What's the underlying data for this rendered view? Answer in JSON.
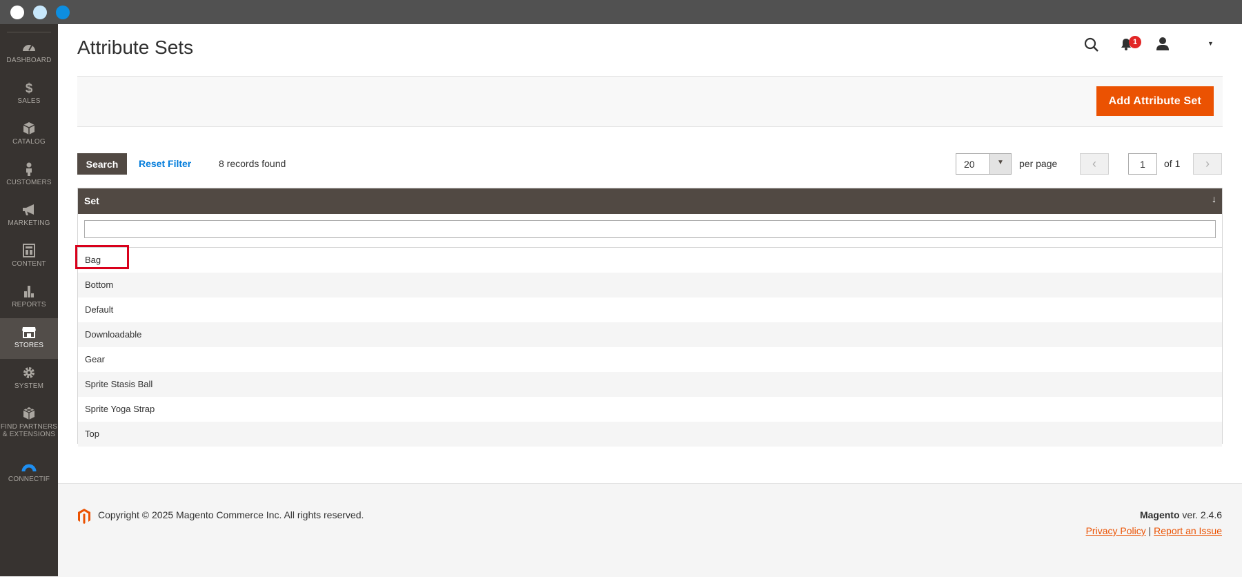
{
  "sidebar": {
    "items": [
      {
        "label": "DASHBOARD",
        "icon": "dashboard-icon"
      },
      {
        "label": "SALES",
        "icon": "dollar-icon"
      },
      {
        "label": "CATALOG",
        "icon": "box-icon"
      },
      {
        "label": "CUSTOMERS",
        "icon": "person-icon"
      },
      {
        "label": "MARKETING",
        "icon": "megaphone-icon"
      },
      {
        "label": "CONTENT",
        "icon": "layout-icon"
      },
      {
        "label": "REPORTS",
        "icon": "bar-chart-icon"
      },
      {
        "label": "STORES",
        "icon": "storefront-icon"
      },
      {
        "label": "SYSTEM",
        "icon": "gear-icon"
      },
      {
        "label": "FIND PARTNERS & EXTENSIONS",
        "icon": "cubes-icon"
      },
      {
        "label": "CONNECTIF",
        "icon": "connectif-icon"
      }
    ],
    "active": "STORES"
  },
  "header": {
    "title": "Attribute Sets",
    "notification_count": "1"
  },
  "actions": {
    "add_label": "Add Attribute Set"
  },
  "toolbar": {
    "search_label": "Search",
    "reset_label": "Reset Filter",
    "records_found": "8 records found",
    "per_page_value": "20",
    "per_page_label": "per page",
    "page_current": "1",
    "page_of": "of 1"
  },
  "grid": {
    "column_header": "Set",
    "sort_indicator": "↓",
    "rows": [
      "Bag",
      "Bottom",
      "Default",
      "Downloadable",
      "Gear",
      "Sprite Stasis Ball",
      "Sprite Yoga Strap",
      "Top"
    ]
  },
  "footer": {
    "copyright": "Copyright © 2025 Magento Commerce Inc. All rights reserved.",
    "brand": "Magento",
    "version": " ver. 2.4.6",
    "privacy_label": "Privacy Policy",
    "separator": "|",
    "report_label": "Report an Issue"
  },
  "colors": {
    "accent": "#eb5202",
    "sidebar_bg": "#373330",
    "grid_header_bg": "#514943",
    "highlight": "#d9001b"
  }
}
